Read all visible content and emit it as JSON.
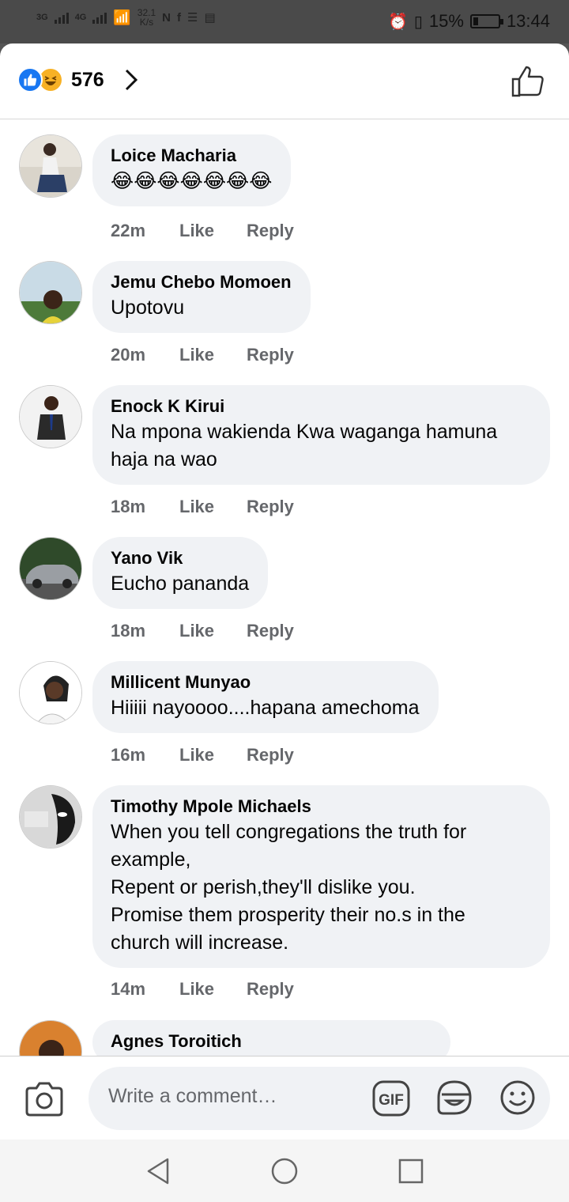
{
  "status_bar": {
    "network_1": "3G",
    "network_2": "4G",
    "speed_value": "32.1",
    "speed_unit": "K/s",
    "battery": "15%",
    "time": "13:44"
  },
  "reactions": {
    "count": "576"
  },
  "comments": [
    {
      "name": "Loice Macharia",
      "text": "😂😂😂😂😂😂😂",
      "time": "22m",
      "like": "Like",
      "reply": "Reply"
    },
    {
      "name": "Jemu Chebo Momoen",
      "text": "Upotovu",
      "time": "20m",
      "like": "Like",
      "reply": "Reply"
    },
    {
      "name": "Enock K Kirui",
      "text": "Na mpona wakienda Kwa waganga hamuna\nhaja na wao",
      "time": "18m",
      "like": "Like",
      "reply": "Reply"
    },
    {
      "name": "Yano Vik",
      "text": "Eucho pananda",
      "time": "18m",
      "like": "Like",
      "reply": "Reply"
    },
    {
      "name": "Millicent Munyao",
      "text": "Hiiiii nayoooo....hapana amechoma",
      "time": "16m",
      "like": "Like",
      "reply": "Reply"
    },
    {
      "name": "Timothy Mpole Michaels",
      "text": "When you tell congregations  the truth for\nexample,\nRepent or perish,they'll  dislike  you.\nPromise  them prosperity their no.s in the\nchurch will increase.",
      "time": "14m",
      "like": "Like",
      "reply": "Reply"
    },
    {
      "name": "Agnes Toroitich",
      "text": "",
      "time": "",
      "like": "",
      "reply": ""
    }
  ],
  "composer": {
    "placeholder": "Write a comment…",
    "gif_label": "GIF"
  },
  "colors": {
    "facebook_blue": "#1877f2",
    "bubble_bg": "#f0f2f5",
    "meta_gray": "#65676b"
  }
}
